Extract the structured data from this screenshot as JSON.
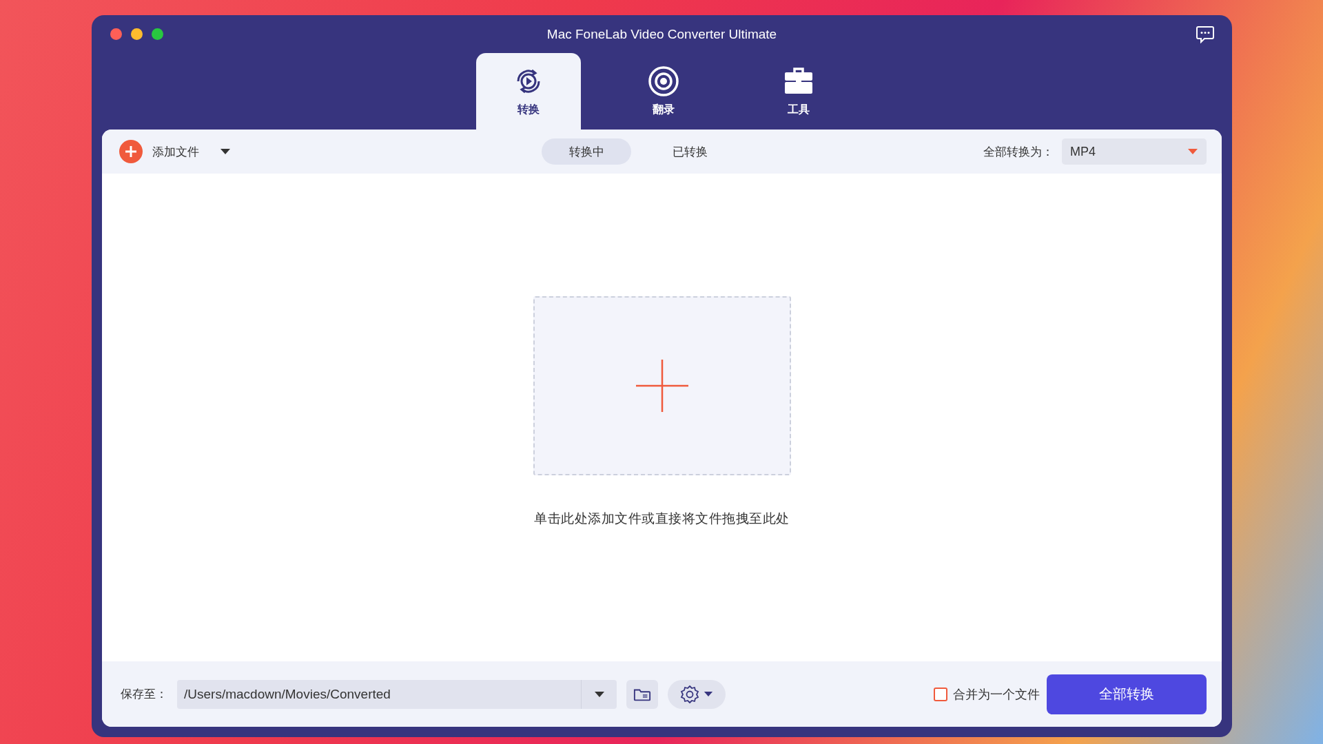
{
  "window": {
    "title": "Mac FoneLab Video Converter Ultimate"
  },
  "tabs": [
    {
      "kind": "convert",
      "label": "转换",
      "selected": true
    },
    {
      "kind": "record",
      "label": "翻录",
      "selected": false
    },
    {
      "kind": "tools",
      "label": "工具",
      "selected": false
    }
  ],
  "toolbar": {
    "add_files": "添加文件",
    "filters": [
      {
        "label": "转换中",
        "selected": true
      },
      {
        "label": "已转换",
        "selected": false
      }
    ],
    "convert_all_to": {
      "label": "全部转换为：",
      "value": "MP4"
    }
  },
  "drop_zone": {
    "hint": "单击此处添加文件或直接将文件拖拽至此处"
  },
  "bottom_bar": {
    "save_to": {
      "label": "保存至：",
      "value": "/Users/macdown/Movies/Converted"
    },
    "merge": {
      "label": "合并为一个文件",
      "checked": false
    },
    "convert_all_button": "全部转换"
  }
}
